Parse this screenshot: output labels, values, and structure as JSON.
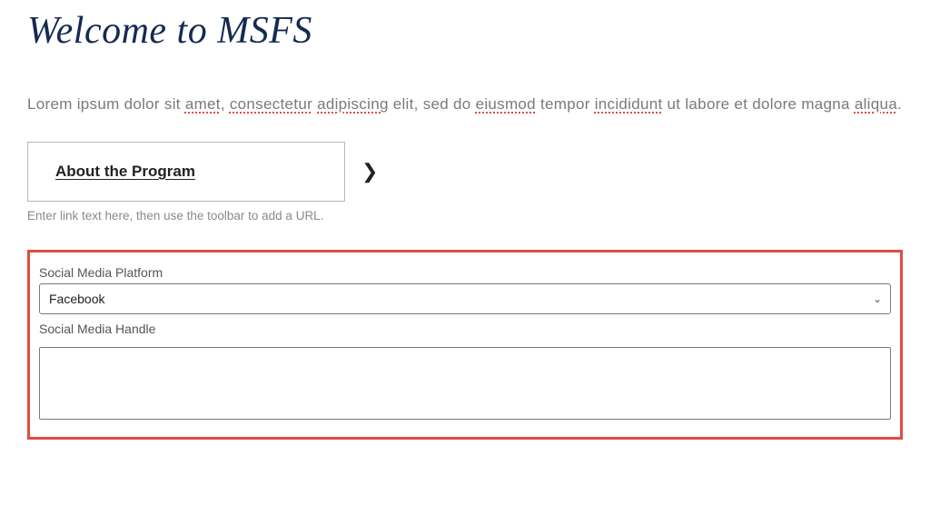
{
  "page_title": "Welcome to MSFS",
  "body_text": {
    "parts": [
      {
        "t": "Lorem ipsum dolor sit "
      },
      {
        "t": "amet",
        "sc": true
      },
      {
        "t": ", "
      },
      {
        "t": "consectetur",
        "sc": true
      },
      {
        "t": " "
      },
      {
        "t": "adipiscing",
        "sc": true
      },
      {
        "t": " elit, sed do "
      },
      {
        "t": "eiusmod",
        "sc": true
      },
      {
        "t": " tempor "
      },
      {
        "t": "incididunt",
        "sc": true
      },
      {
        "t": " ut labore et dolore magna "
      },
      {
        "t": "aliqua",
        "sc": true
      },
      {
        "t": "."
      }
    ]
  },
  "cta": {
    "label": "About the Program"
  },
  "helper_text": "Enter link text here, then use the toolbar to add a URL.",
  "form": {
    "platform_label": "Social Media Platform",
    "platform_value": "Facebook",
    "handle_label": "Social Media Handle",
    "handle_value": ""
  }
}
